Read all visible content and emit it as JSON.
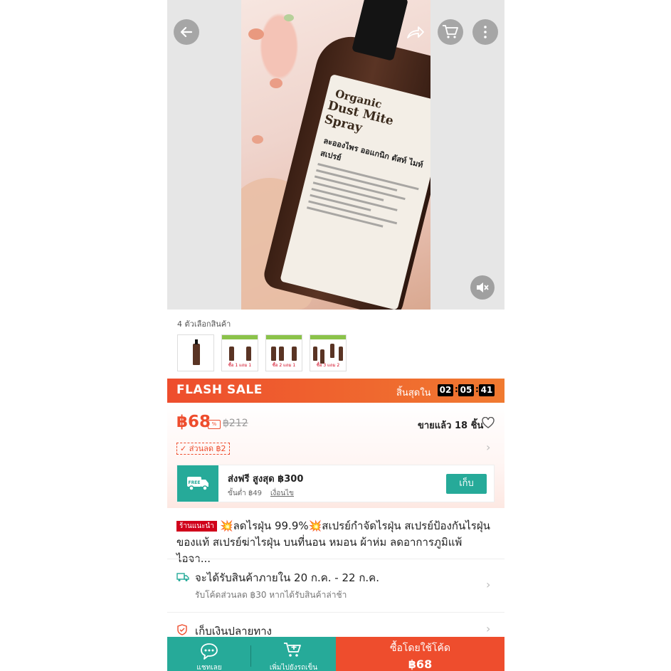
{
  "variants": {
    "label": "4 ตัวเลือกสินค้า",
    "thumb_tags": [
      "",
      "ซื้อ 1 แถม 1",
      "ซื้อ 2 แถม 1",
      "ซื้อ 3 แถม 2"
    ]
  },
  "product_image": {
    "label_line1": "Organic",
    "label_line2": "Dust Mite Spray",
    "label_thai": "ละอองไพร ออแกนิก ดัสท์ ไมท์ สเปรย์"
  },
  "flash_sale": {
    "title": "FLASH SALE",
    "ends_in_label": "สิ้นสุดใน",
    "hours": "02",
    "minutes": "05",
    "seconds": "41"
  },
  "price": {
    "current": "฿68",
    "original": "฿212",
    "sold": "ขายแล้ว 18 ชิ้น",
    "coupon": "ส่วนลด ฿2"
  },
  "shipping": {
    "badge": "FREE",
    "title": "ส่งฟรี สูงสุด ฿300",
    "min_spend": "ขั้นต่ำ ฿49",
    "conditions": "เงื่อนไข",
    "collect_label": "เก็บ"
  },
  "title": {
    "badge": "ร้านแนะนำ",
    "text": "💥ลดไรฝุ่น 99.9%💥สเปรย์กำจัดไรฝุ่น สเปรย์ป้องกันไรฝุ่นของแท้ สเปรย์ฆ่าไรฝุ่น บนที่นอน หมอน ผ้าห่ม ลดอาการภูมิแพ้ ไอจา..."
  },
  "delivery": {
    "title": "จะได้รับสินค้าภายใน 20 ก.ค. - 22 ก.ค.",
    "subtitle": "รับโค้ดส่วนลด ฿30 หากได้รับสินค้าล่าช้า"
  },
  "cod": {
    "title": "เก็บเงินปลายทาง"
  },
  "bottom_bar": {
    "chat_label": "แชทเลย",
    "cart_label": "เพิ่มไปยังรถเข็น",
    "buy_line1": "ซื้อโดยใช้โค้ด",
    "buy_price": "฿68"
  },
  "colors": {
    "accent": "#ee4d2d",
    "teal": "#26aa99"
  }
}
